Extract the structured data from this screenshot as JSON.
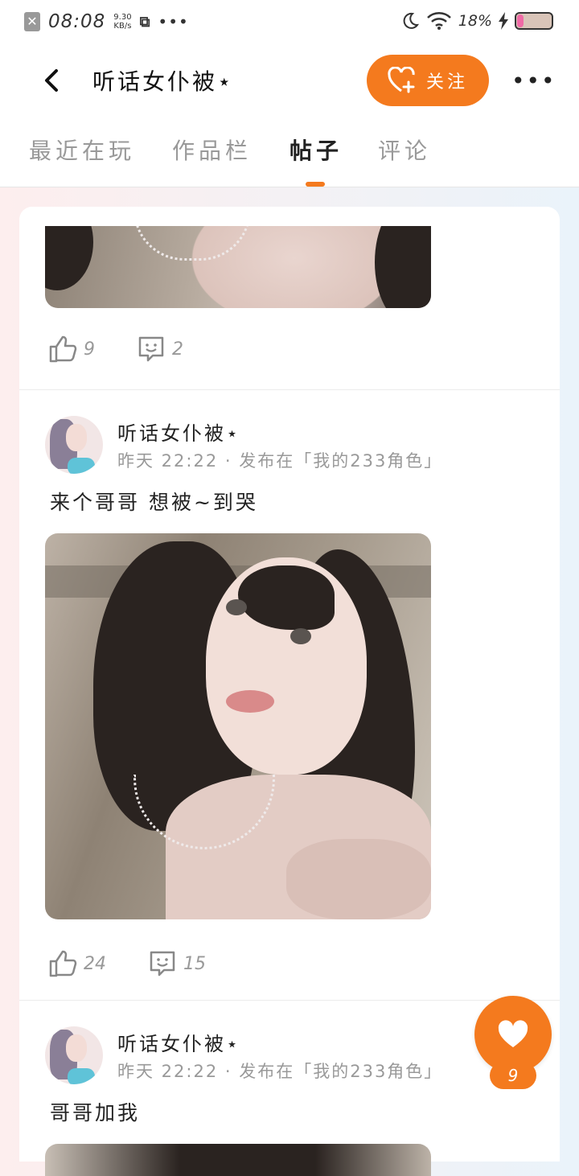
{
  "status_bar": {
    "time": "08:08",
    "speed_value": "9.30",
    "speed_unit": "KB/s",
    "battery": "18%"
  },
  "nav": {
    "title": "听话女仆被⋆",
    "follow_label": "关注",
    "more": "•••"
  },
  "tabs": [
    {
      "label": "最近在玩",
      "active": false
    },
    {
      "label": "作品栏",
      "active": false
    },
    {
      "label": "帖子",
      "active": true
    },
    {
      "label": "评论",
      "active": false
    }
  ],
  "posts": [
    {
      "likes": "9",
      "comments": "2"
    },
    {
      "author": "听话女仆被⋆",
      "meta": "昨天 22:22 · 发布在「我的233角色」",
      "text": "来个哥哥 想被~到哭",
      "likes": "24",
      "comments": "15"
    },
    {
      "author": "听话女仆被⋆",
      "meta": "昨天 22:22 · 发布在「我的233角色」",
      "text": "哥哥加我"
    }
  ],
  "fab": {
    "count": "9"
  },
  "colors": {
    "accent": "#f47a1e"
  }
}
